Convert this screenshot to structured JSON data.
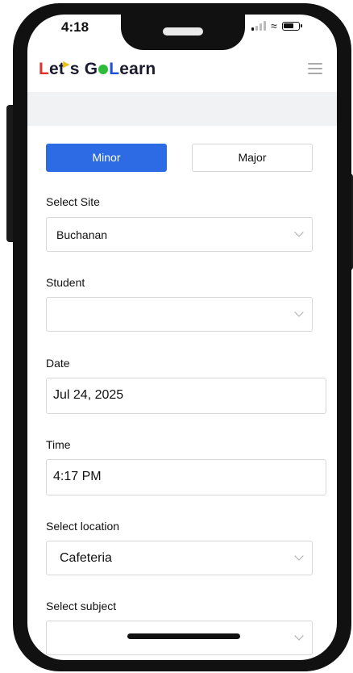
{
  "status_bar": {
    "time": "4:18"
  },
  "header": {
    "logo_text": "Let's GoLearn"
  },
  "tabs": {
    "minor": "Minor",
    "major": "Major"
  },
  "site": {
    "label": "Select Site",
    "value": "Buchanan"
  },
  "student": {
    "label": "Student",
    "value": ""
  },
  "date": {
    "label": "Date",
    "value": "Jul 24, 2025"
  },
  "time": {
    "label": "Time",
    "value": "4:17 PM"
  },
  "location": {
    "label": "Select location",
    "value": "Cafeteria"
  },
  "subject": {
    "label": "Select subject",
    "value": ""
  },
  "colors": {
    "accent": "#2d6be4",
    "logo_red": "#e0322d",
    "logo_green": "#2dbd3b",
    "logo_blue": "#1d4fd8",
    "logo_yellow": "#e9c21a"
  }
}
